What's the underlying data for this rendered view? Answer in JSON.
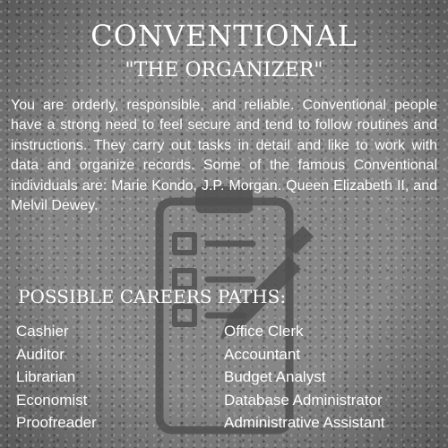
{
  "title": "CONVENTIONAL",
  "subtitle": "\"THE ORGANIZER\"",
  "description": "You are orderly, responsible, and reliable. Conventional people have a strong need to feel secure and tend to follow routines and instructions. They carry out tasks in detail and like to work with data and organize records. Some of the famous Conventional individuals are: Marie Kondo, J.P. Morgan. Queen Elizabeth II, and Melvil Dewey.",
  "careers_heading": "POSSIBLE CAREERS PATHS:",
  "careers_left": [
    "Cashier",
    "Auditor",
    "Librarian",
    "Economist",
    "Proofreader"
  ],
  "careers_right": [
    "Office Clerk",
    "Accountant",
    "Budget Analyst",
    "Database Administrator",
    "Administrative Assistant"
  ],
  "colors": {
    "background": "#878787",
    "text": "#ffffff",
    "icon": "#505050"
  },
  "icon": "checklist-clipboard-pencil-icon"
}
